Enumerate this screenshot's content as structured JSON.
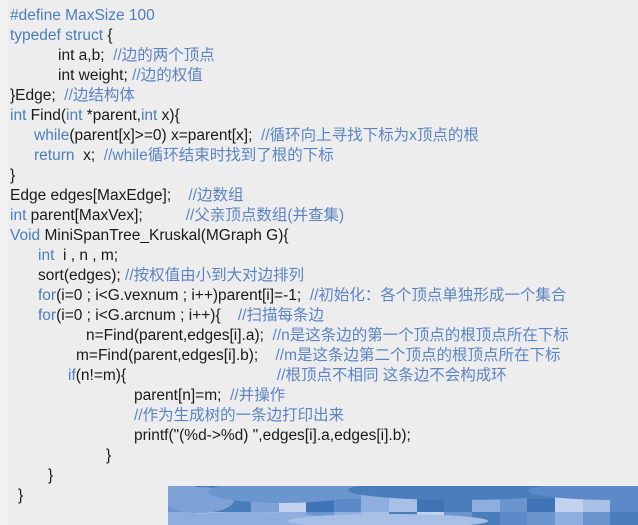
{
  "document": {
    "kind": "code-snippet-screenshot",
    "language": "C",
    "background_color": "#ededed",
    "keyword_color": "#4a7ebb",
    "comment_color": "#5b84c4",
    "plain_color": "#1a1a1a"
  },
  "code": {
    "lines": [
      {
        "indent": 0,
        "tokens": [
          {
            "t": "kw",
            "s": "#define MaxSize 100"
          }
        ]
      },
      {
        "indent": 0,
        "tokens": [
          {
            "t": "kw",
            "s": "typedef struct"
          },
          {
            "t": "pl",
            "s": " {"
          }
        ]
      },
      {
        "indent": 48,
        "tokens": [
          {
            "t": "pl",
            "s": "int a,b;  "
          },
          {
            "t": "cm",
            "s": "//边的两个顶点"
          }
        ]
      },
      {
        "indent": 48,
        "tokens": [
          {
            "t": "pl",
            "s": "int weight; "
          },
          {
            "t": "cm",
            "s": "//边的权值"
          }
        ]
      },
      {
        "indent": 0,
        "tokens": [
          {
            "t": "pl",
            "s": "}Edge;  "
          },
          {
            "t": "cm",
            "s": "//边结构体"
          }
        ]
      },
      {
        "indent": 0,
        "tokens": [
          {
            "t": "kw",
            "s": "int"
          },
          {
            "t": "pl",
            "s": " Find("
          },
          {
            "t": "kw",
            "s": "int"
          },
          {
            "t": "pl",
            "s": " *parent,"
          },
          {
            "t": "kw",
            "s": "int"
          },
          {
            "t": "pl",
            "s": " x){"
          }
        ]
      },
      {
        "indent": 24,
        "tokens": [
          {
            "t": "kw",
            "s": "while"
          },
          {
            "t": "pl",
            "s": "(parent[x]>=0) x=parent[x];  "
          },
          {
            "t": "cm",
            "s": "//循环向上寻找下标为x顶点的根"
          }
        ]
      },
      {
        "indent": 24,
        "tokens": [
          {
            "t": "kw",
            "s": "return"
          },
          {
            "t": "pl",
            "s": "  x;  "
          },
          {
            "t": "cm",
            "s": "//while循环结束时找到了根的下标"
          }
        ]
      },
      {
        "indent": 0,
        "tokens": [
          {
            "t": "pl",
            "s": "}"
          }
        ]
      },
      {
        "indent": 0,
        "tokens": [
          {
            "t": "pl",
            "s": "Edge edges[MaxEdge];    "
          },
          {
            "t": "cm",
            "s": "//边数组"
          }
        ]
      },
      {
        "indent": 0,
        "tokens": [
          {
            "t": "kw",
            "s": "int"
          },
          {
            "t": "pl",
            "s": " parent[MaxVex];          "
          },
          {
            "t": "cm",
            "s": "//父亲顶点数组(并查集)"
          }
        ]
      },
      {
        "indent": 0,
        "tokens": [
          {
            "t": "kw",
            "s": "Void"
          },
          {
            "t": "pl",
            "s": " MiniSpanTree_Kruskal(MGraph G){"
          }
        ]
      },
      {
        "indent": 28,
        "tokens": [
          {
            "t": "kw",
            "s": "int"
          },
          {
            "t": "pl",
            "s": "  i , n , m;"
          }
        ]
      },
      {
        "indent": 28,
        "tokens": [
          {
            "t": "pl",
            "s": "sort(edges); "
          },
          {
            "t": "cm",
            "s": "//按权值由小到大对边排列"
          }
        ]
      },
      {
        "indent": 28,
        "tokens": [
          {
            "t": "kw",
            "s": "for"
          },
          {
            "t": "pl",
            "s": "(i=0 ; i<G.vexnum ; i++)parent[i]=-1;  "
          },
          {
            "t": "cm",
            "s": "//初始化：各个顶点单独形成一个集合"
          }
        ]
      },
      {
        "indent": 28,
        "tokens": [
          {
            "t": "kw",
            "s": "for"
          },
          {
            "t": "pl",
            "s": "(i=0 ; i<G.arcnum ; i++){    "
          },
          {
            "t": "cm",
            "s": "//扫描每条边"
          }
        ]
      },
      {
        "indent": 76,
        "tokens": [
          {
            "t": "pl",
            "s": "n=Find(parent,edges[i].a);  "
          },
          {
            "t": "cm",
            "s": "//n是这条边的第一个顶点的根顶点所在下标"
          }
        ]
      },
      {
        "indent": 66,
        "tokens": [
          {
            "t": "pl",
            "s": "m=Find(parent,edges[i].b);    "
          },
          {
            "t": "cm",
            "s": "//m是这条边第二个顶点的根顶点所在下标"
          }
        ]
      },
      {
        "indent": 58,
        "tokens": [
          {
            "t": "kw",
            "s": "if"
          },
          {
            "t": "pl",
            "s": "(n!=m){                                   "
          },
          {
            "t": "cm",
            "s": "//根顶点不相同 这条边不会构成环"
          }
        ]
      },
      {
        "indent": 124,
        "tokens": [
          {
            "t": "pl",
            "s": "parent[n]=m;  "
          },
          {
            "t": "cm",
            "s": "//并操作"
          }
        ]
      },
      {
        "indent": 124,
        "tokens": [
          {
            "t": "cm",
            "s": "//作为生成树的一条边打印出来"
          }
        ]
      },
      {
        "indent": 124,
        "tokens": [
          {
            "t": "pl",
            "s": "printf(\"(%d->%d) \",edges[i].a,edges[i].b);"
          }
        ]
      },
      {
        "indent": 96,
        "tokens": [
          {
            "t": "pl",
            "s": "}"
          }
        ]
      },
      {
        "indent": 38,
        "tokens": [
          {
            "t": "pl",
            "s": "}"
          }
        ]
      },
      {
        "indent": 8,
        "tokens": [
          {
            "t": "pl",
            "s": "}"
          }
        ]
      }
    ]
  },
  "watermark": {
    "name": "pixelated-blue-banner",
    "description": "mosaic-censored blue banner strip at lower right",
    "colors": [
      "#4a7ebb",
      "#6b95cf",
      "#8fadde",
      "#a8c0e6",
      "#c3d3ef",
      "#3e73b5",
      "#5c89c8"
    ],
    "grid": [
      [
        "#7ea1d7",
        "#4a7ebb",
        "#4a7ebb",
        "#6b95cf",
        "#a8c0e6",
        "#4a7ebb",
        "#6b95cf",
        "#8fadde",
        "#a8c0e6",
        "#6b95cf",
        "#4a7ebb",
        "#8fadde",
        "#6b95cf",
        "#4a7ebb",
        "#c3d3ef",
        "#8fadde",
        "#6b95cf"
      ],
      [
        "#6b95cf",
        "#4a7ebb",
        "#4a7ebb",
        "#7ea1d7",
        "#c3d3ef",
        "#3e73b5",
        "#5c89c8",
        "#8fadde",
        "#a8c0e6",
        "#3e73b5",
        "#4a7ebb",
        "#8fadde",
        "#6b95cf",
        "#3e73b5",
        "#c3d3ef",
        "#a8c0e6",
        "#5c89c8"
      ],
      [
        "#8fadde",
        "#a8c0e6",
        "#8fadde",
        "#a8c0e6",
        "#8fadde",
        "#6b95cf",
        "#8fadde",
        "#a8c0e6",
        "#4a7ebb",
        "#c3d3ef",
        "#6b95cf",
        "#4a7ebb",
        "#5c89c8",
        "#6b95cf",
        "#8fadde",
        "#6b95cf",
        "#4a7ebb"
      ]
    ]
  }
}
